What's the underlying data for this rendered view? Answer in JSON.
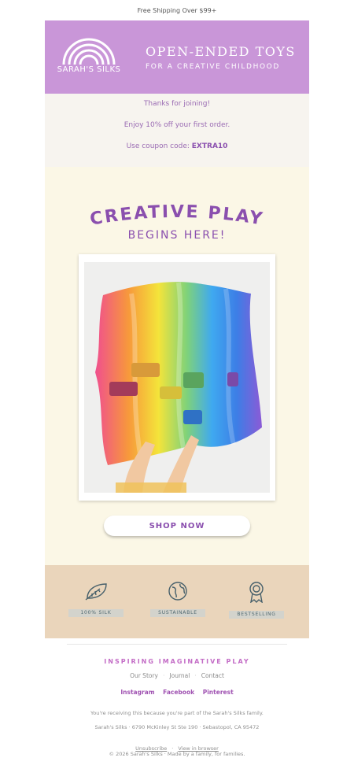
{
  "topbar": {
    "text": "Free Shipping Over $99+"
  },
  "header": {
    "brand": "SARAH'S SILKS",
    "tagline_1": "OPEN-ENDED TOYS",
    "tagline_2": "FOR A CREATIVE CHILDHOOD",
    "bg_color": "#c996d8"
  },
  "join": {
    "line1": "Thanks for joining!",
    "line2": "Enjoy 10% off your first order.",
    "line3_prefix": "Use coupon code: ",
    "coupon": "EXTRA10"
  },
  "hero": {
    "headline": "CREATIVE PLAY",
    "subheadline": "BEGINS HERE!",
    "cta": "SHOP NOW"
  },
  "badges": [
    {
      "icon": "leaf-icon",
      "label": "100% SILK"
    },
    {
      "icon": "globe-icon",
      "label": "SUSTAINABLE"
    },
    {
      "icon": "award-ribbon-icon",
      "label": "BESTSELLING"
    }
  ],
  "footer": {
    "heading": "INSPIRING IMAGINATIVE PLAY",
    "nav": [
      "Our Story",
      "Journal",
      "Contact"
    ],
    "social": [
      "Instagram",
      "Facebook",
      "Pinterest"
    ],
    "notice": "You're receiving this because you're part of the Sarah's Silks family.",
    "address": "Sarah's Silks · 6790 McKinley St Ste 190 · Sebastopol, CA 95472",
    "unsubscribe": "Unsubscribe",
    "view_browser": "View in browser",
    "copyright": "© 2026 Sarah's Silks · Made by a family, for families."
  }
}
